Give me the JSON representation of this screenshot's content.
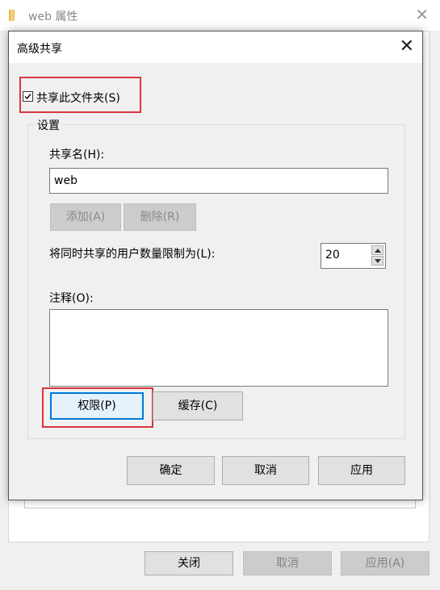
{
  "parent_window": {
    "title": "web 属性",
    "close_glyph": "✕",
    "buttons": {
      "close": "关闭",
      "cancel": "取消",
      "apply": "应用(A)"
    }
  },
  "dialog": {
    "title": "高级共享",
    "close_glyph": "✕",
    "share_checkbox": {
      "label": "共享此文件夹(S)",
      "checked": true
    },
    "settings_group": {
      "legend": "设置",
      "share_name_label": "共享名(H):",
      "share_name_value": "web",
      "add_button": "添加(A)",
      "remove_button": "删除(R)",
      "user_limit_label": "将同时共享的用户数量限制为(L):",
      "user_limit_value": "20",
      "comment_label": "注释(O):",
      "comment_value": "",
      "permissions_button": "权限(P)",
      "caching_button": "缓存(C)"
    },
    "footer": {
      "ok": "确定",
      "cancel": "取消",
      "apply": "应用"
    }
  },
  "colors": {
    "highlight": "#d9363e",
    "focus_border": "#0078d7",
    "folder_icon": "#e8b84a"
  }
}
